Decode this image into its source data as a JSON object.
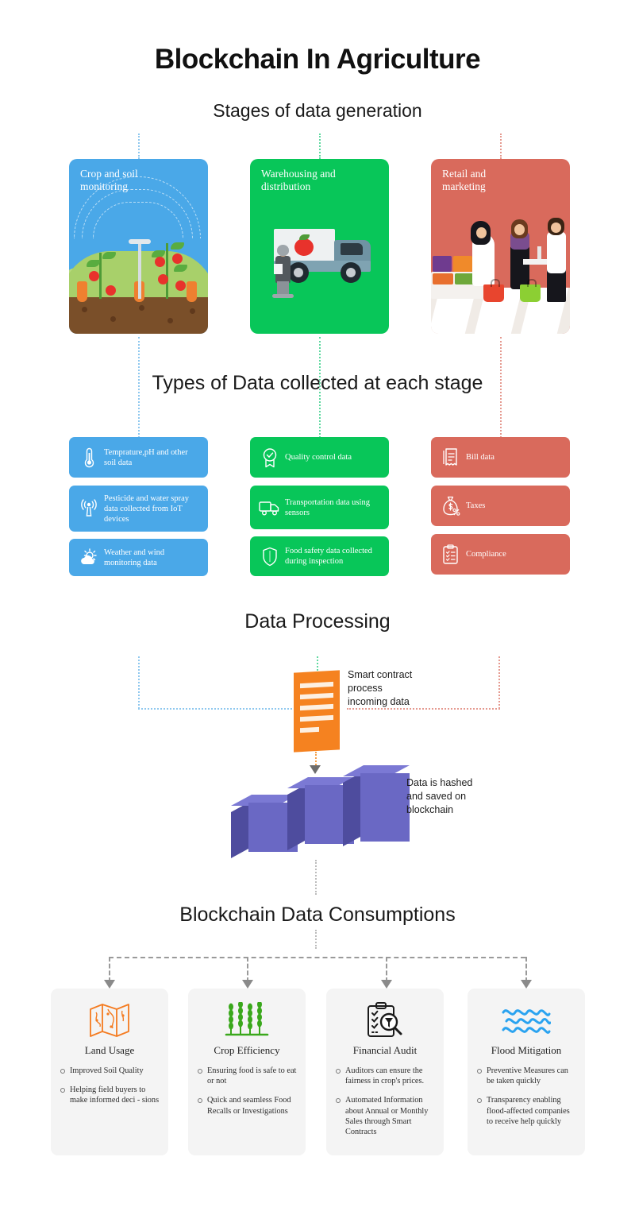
{
  "title": "Blockchain In Agriculture",
  "sections": {
    "stages_heading": "Stages of data generation",
    "types_heading": "Types of Data collected at each stage",
    "processing_heading": "Data Processing",
    "consumption_heading": "Blockchain Data Consumptions"
  },
  "stages": [
    {
      "label": "Crop and soil\nmonitoring",
      "color": "#4aa8e8",
      "scene": "field-sprinkler-tomato-plants"
    },
    {
      "label": "Warehousing and\ndistribution",
      "color": "#08c659",
      "scene": "delivery-truck-worker"
    },
    {
      "label": "Retail and\nmarketing",
      "color": "#d96a5c",
      "scene": "grocery-store-shoppers"
    }
  ],
  "data_types": {
    "blue": {
      "color": "#4aa8e8",
      "items": [
        {
          "icon": "thermometer-icon",
          "text": "Temprature,pH and other soil data"
        },
        {
          "icon": "signal-tower-icon",
          "text": "Pesticide and water spray data collected from IoT devices"
        },
        {
          "icon": "weather-cloud-sun-icon",
          "text": "Weather and wind monitoring data"
        }
      ]
    },
    "green": {
      "color": "#08c659",
      "items": [
        {
          "icon": "quality-badge-icon",
          "text": "Quality control data"
        },
        {
          "icon": "truck-icon",
          "text": "Transportation data using sensors"
        },
        {
          "icon": "shield-icon",
          "text": "Food safety data collected during inspection"
        }
      ]
    },
    "red": {
      "color": "#d96a5c",
      "items": [
        {
          "icon": "receipt-icon",
          "text": "Bill data"
        },
        {
          "icon": "money-bag-percent-icon",
          "text": "Taxes"
        },
        {
          "icon": "clipboard-check-icon",
          "text": "Compliance"
        }
      ]
    }
  },
  "processing": {
    "contract_note": "Smart contract\nprocess\nincoming data",
    "block_note": "Data is hashed\nand saved on\nblockchain",
    "contract_color": "#f58220",
    "block_color": "#6a68c4"
  },
  "consumption": [
    {
      "icon": "folded-map-icon",
      "icon_color": "#f47b20",
      "title": "Land Usage",
      "points": [
        "Improved Soil Quality",
        "Helping field buyers to make informed deci    - sions"
      ]
    },
    {
      "icon": "wheat-crops-icon",
      "icon_color": "#3aa81c",
      "title": "Crop Efficiency",
      "points": [
        "Ensuring food is safe to eat or not",
        "Quick and seamless Food Recalls or Investigations"
      ]
    },
    {
      "icon": "audit-clipboard-magnifier-icon",
      "icon_color": "#1a1a1a",
      "title": "Financial Audit",
      "points": [
        "Auditors can ensure the fairness in crop's prices.",
        "Automated Information about Annual or Monthly Sales through Smart Contracts"
      ]
    },
    {
      "icon": "water-waves-icon",
      "icon_color": "#2aa3f0",
      "title": "Flood Mitigation",
      "points": [
        "Preventive Measures can be taken quickly",
        "Transparency enabling flood-affected companies to receive help quickly"
      ]
    }
  ]
}
